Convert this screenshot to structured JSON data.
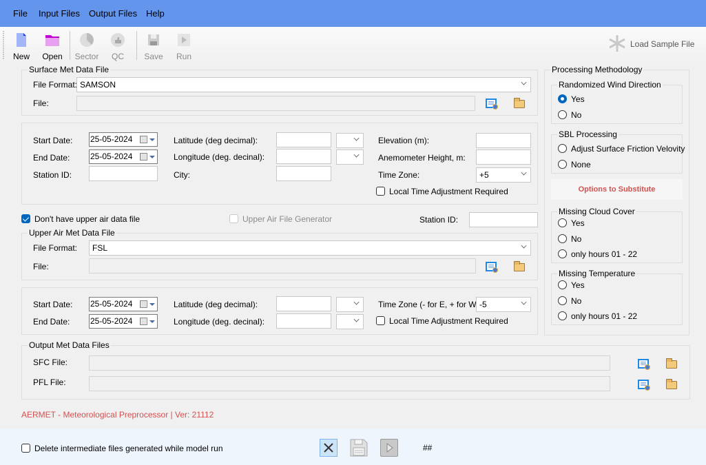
{
  "menu": [
    "File",
    "Input Files",
    "Output Files",
    "Help"
  ],
  "toolbar": {
    "new": "New",
    "open": "Open",
    "sector": "Sector",
    "qc": "QC",
    "save": "Save",
    "run": "Run",
    "load_sample": "Load Sample File"
  },
  "surface": {
    "title": "Surface Met Data File",
    "file_format_label": "File Format:",
    "file_format_value": "SAMSON",
    "file_label": "File:",
    "file_value": "",
    "start_date_label": "Start Date:",
    "start_date": "25-05-2024",
    "end_date_label": "End Date:",
    "end_date": "25-05-2024",
    "station_id_label": "Station ID:",
    "station_id": "",
    "latitude_label": "Latitude (deg decimal):",
    "longitude_label": "Longitude (deg. decinal):",
    "city_label": "City:",
    "elevation_label": "Elevation (m):",
    "anemometer_label": "Anemometer Height, m:",
    "timezone_label": "Time Zone:",
    "timezone_value": "+5",
    "local_time_label": "Local Time Adjustment Required",
    "local_time_checked": false
  },
  "upper_air": {
    "no_upper_air_label": "Don't have upper air data file",
    "no_upper_air_checked": true,
    "generator_label": "Upper Air File Generator",
    "station_id_label": "Station ID:",
    "station_id": "",
    "title": "Upper Air Met Data File",
    "file_format_label": "File Format:",
    "file_format_value": "FSL",
    "file_label": "File:",
    "start_date_label": "Start Date:",
    "start_date": "25-05-2024",
    "end_date_label": "End Date:",
    "end_date": "25-05-2024",
    "latitude_label": "Latitude (deg decimal):",
    "longitude_label": "Longitude (deg. decinal):",
    "timezone_label": "Time Zone (- for E, + for W)",
    "timezone_value": "-5",
    "local_time_label": "Local Time Adjustment Required",
    "local_time_checked": false
  },
  "output": {
    "title": "Output Met Data Files",
    "sfc_label": "SFC File:",
    "pfl_label": "PFL File:"
  },
  "processing": {
    "title": "Processing Methodology",
    "wind_title": "Randomized Wind Direction",
    "wind_options": [
      "Yes",
      "No"
    ],
    "wind_selected": "Yes",
    "sbl_title": "SBL Processing",
    "sbl_options": [
      "Adjust Surface Friction Velovity",
      "None"
    ],
    "substitute_label": "Options to Substitute",
    "cloud_title": "Missing Cloud Cover",
    "cloud_options": [
      "Yes",
      "No",
      "only hours 01 - 22"
    ],
    "temp_title": "Missing Temperature",
    "temp_options": [
      "Yes",
      "No",
      "only hours 01 - 22"
    ]
  },
  "version_text": "AERMET - Meteorological Preprocessor | Ver: 21112",
  "footer": {
    "delete_label": "Delete intermediate files generated while model run",
    "delete_checked": false,
    "hash_label": "##"
  },
  "colors": {
    "menubar": "#6495ed",
    "accent": "#0067c0",
    "red_text": "#d2504f"
  }
}
